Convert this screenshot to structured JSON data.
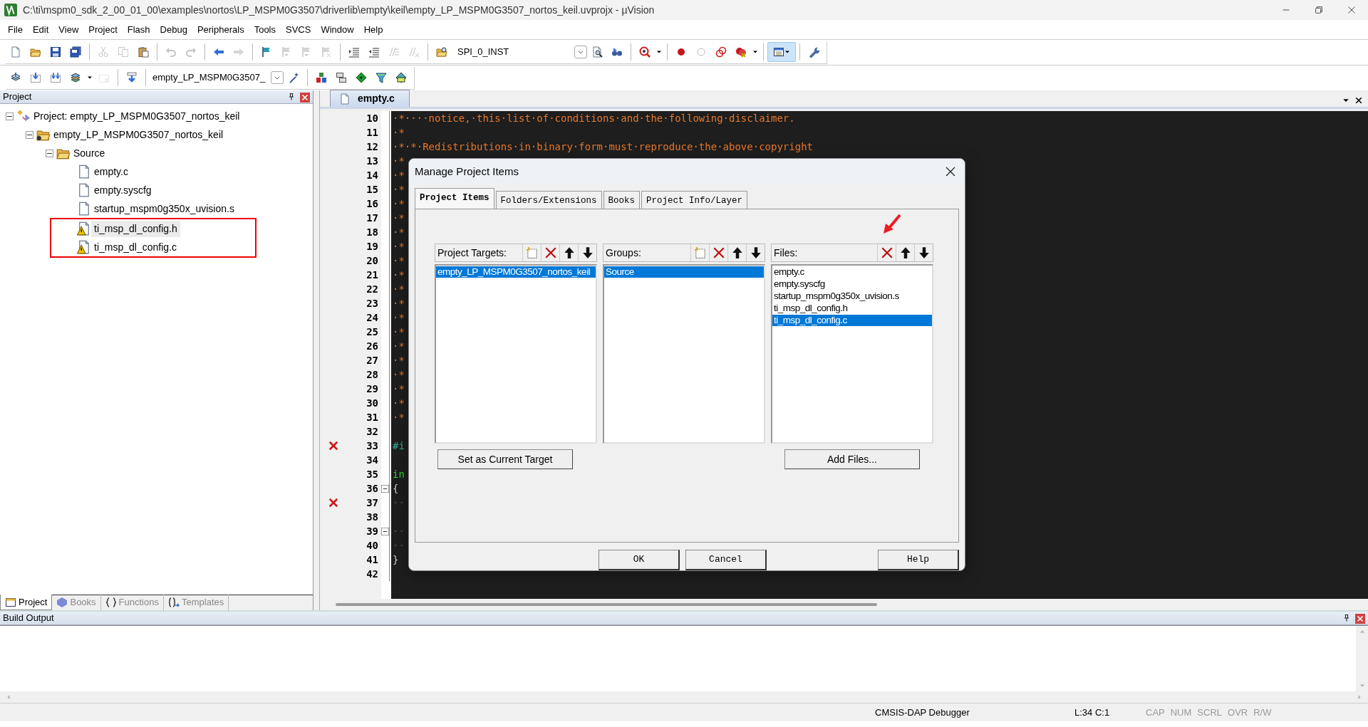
{
  "window": {
    "title": "C:\\ti\\mspm0_sdk_2_00_01_00\\examples\\nortos\\LP_MSPM0G3507\\driverlib\\empty\\keil\\empty_LP_MSPM0G3507_nortos_keil.uvprojx - µVision"
  },
  "menu": [
    "File",
    "Edit",
    "View",
    "Project",
    "Flash",
    "Debug",
    "Peripherals",
    "Tools",
    "SVCS",
    "Window",
    "Help"
  ],
  "toolbars": [
    {
      "items": [
        {
          "kind": "new",
          "disabled": false,
          "pressed": false
        },
        {
          "kind": "open",
          "disabled": false,
          "pressed": false
        },
        {
          "kind": "save",
          "disabled": false,
          "pressed": false
        },
        {
          "kind": "save-all",
          "disabled": false,
          "pressed": false
        },
        {
          "kind": "sep"
        },
        {
          "kind": "cut",
          "disabled": true,
          "pressed": false
        },
        {
          "kind": "copy",
          "disabled": true,
          "pressed": false
        },
        {
          "kind": "paste",
          "disabled": false,
          "pressed": false
        },
        {
          "kind": "sep"
        },
        {
          "kind": "undo",
          "disabled": true,
          "pressed": false
        },
        {
          "kind": "redo",
          "disabled": true,
          "pressed": false
        },
        {
          "kind": "sep"
        },
        {
          "kind": "back",
          "disabled": false,
          "pressed": false
        },
        {
          "kind": "forward",
          "disabled": true,
          "pressed": false
        },
        {
          "kind": "sep"
        },
        {
          "kind": "flag",
          "disabled": false,
          "pressed": false
        },
        {
          "kind": "flag-prev",
          "disabled": true,
          "pressed": false
        },
        {
          "kind": "flag-next",
          "disabled": true,
          "pressed": false
        },
        {
          "kind": "flag-clear",
          "disabled": true,
          "pressed": false
        },
        {
          "kind": "sep"
        },
        {
          "kind": "indent",
          "disabled": false,
          "pressed": false
        },
        {
          "kind": "unindent",
          "disabled": false,
          "pressed": false
        },
        {
          "kind": "comment",
          "disabled": true,
          "pressed": false
        },
        {
          "kind": "uncomment",
          "disabled": true,
          "pressed": false
        },
        {
          "kind": "sep"
        },
        {
          "kind": "find-files",
          "disabled": false,
          "pressed": false
        },
        {
          "kind": "combo",
          "value": "SPI_0_INST"
        },
        {
          "kind": "find",
          "disabled": false,
          "pressed": false
        },
        {
          "kind": "incremental",
          "disabled": false,
          "pressed": false
        },
        {
          "kind": "sep"
        },
        {
          "kind": "debug",
          "disabled": false,
          "pressed": false
        },
        {
          "kind": "caret"
        },
        {
          "kind": "sep"
        },
        {
          "kind": "breakpoint",
          "disabled": false,
          "pressed": false
        },
        {
          "kind": "breakpoint-off",
          "disabled": false,
          "pressed": false
        },
        {
          "kind": "breakpoints",
          "disabled": false,
          "pressed": false
        },
        {
          "kind": "breakpoints-kill",
          "disabled": false,
          "pressed": false
        },
        {
          "kind": "caret"
        },
        {
          "kind": "sep"
        },
        {
          "kind": "window",
          "disabled": false,
          "pressed": true
        },
        {
          "kind": "sep"
        },
        {
          "kind": "wrench",
          "disabled": false,
          "pressed": false
        }
      ]
    },
    {
      "items": [
        {
          "kind": "translate",
          "disabled": false,
          "pressed": false
        },
        {
          "kind": "build",
          "disabled": false,
          "pressed": false
        },
        {
          "kind": "rebuild",
          "disabled": false,
          "pressed": false
        },
        {
          "kind": "batch",
          "disabled": false,
          "pressed": false
        },
        {
          "kind": "caret"
        },
        {
          "kind": "stop",
          "disabled": true,
          "pressed": false
        },
        {
          "kind": "sep"
        },
        {
          "kind": "load",
          "disabled": false,
          "pressed": false
        },
        {
          "kind": "sep"
        },
        {
          "kind": "combo",
          "value": "empty_LP_MSPM0G3507_"
        },
        {
          "kind": "wand",
          "disabled": false,
          "pressed": false
        },
        {
          "kind": "sep"
        },
        {
          "kind": "manage",
          "disabled": false,
          "pressed": false
        },
        {
          "kind": "layers",
          "disabled": false,
          "pressed": false
        },
        {
          "kind": "diamond",
          "disabled": false,
          "pressed": false
        },
        {
          "kind": "funnel",
          "disabled": false,
          "pressed": false
        },
        {
          "kind": "pack",
          "disabled": false,
          "pressed": false
        }
      ]
    }
  ],
  "project_panel": {
    "title": "Project",
    "tree": [
      {
        "label": "Project: empty_LP_MSPM0G3507_nortos_keil",
        "kind": "project",
        "expanded": true,
        "children": [
          {
            "label": "empty_LP_MSPM0G3507_nortos_keil",
            "kind": "target",
            "expanded": true,
            "children": [
              {
                "label": "Source",
                "kind": "group",
                "expanded": true,
                "children": [
                  {
                    "label": "empty.c",
                    "kind": "file",
                    "selected": false,
                    "marked": false
                  },
                  {
                    "label": "empty.syscfg",
                    "kind": "file",
                    "selected": false,
                    "marked": false
                  },
                  {
                    "label": "startup_mspm0g350x_uvision.s",
                    "kind": "file",
                    "selected": false,
                    "marked": false
                  },
                  {
                    "label": "ti_msp_dl_config.h",
                    "kind": "warning-file",
                    "selected": true,
                    "marked": true
                  },
                  {
                    "label": "ti_msp_dl_config.c",
                    "kind": "warning-file",
                    "selected": false,
                    "marked": true
                  }
                ]
              }
            ]
          }
        ]
      }
    ],
    "tabs": [
      {
        "label": "Project",
        "selected": true
      },
      {
        "label": "Books",
        "selected": false
      },
      {
        "label": "Functions",
        "selected": false
      },
      {
        "label": "Templates",
        "selected": false
      }
    ]
  },
  "editor": {
    "tabs": [
      {
        "label": "empty.c",
        "selected": true
      }
    ],
    "lines": [
      {
        "number": "10",
        "kind": "comment",
        "text": "·*····notice,·this·list·of·conditions·and·the·following·disclaimer.",
        "error": false,
        "fold": false
      },
      {
        "number": "11",
        "kind": "comment",
        "text": "·*",
        "error": false,
        "fold": false
      },
      {
        "number": "12",
        "kind": "comment",
        "text": "·*·*·Redistributions·in·binary·form·must·reproduce·the·above·copyright",
        "error": false,
        "fold": false
      },
      {
        "number": "13",
        "kind": "comment",
        "text": "·*",
        "error": false,
        "fold": false
      },
      {
        "number": "14",
        "kind": "comment",
        "text": "·*",
        "error": false,
        "fold": false
      },
      {
        "number": "15",
        "kind": "comment",
        "text": "·*",
        "error": false,
        "fold": false
      },
      {
        "number": "16",
        "kind": "comment",
        "text": "·*",
        "error": false,
        "fold": false
      },
      {
        "number": "17",
        "kind": "comment",
        "text": "·*",
        "error": false,
        "fold": false
      },
      {
        "number": "18",
        "kind": "comment",
        "text": "·*",
        "error": false,
        "fold": false
      },
      {
        "number": "19",
        "kind": "comment",
        "text": "·*",
        "error": false,
        "fold": false
      },
      {
        "number": "20",
        "kind": "comment",
        "text": "·*",
        "error": false,
        "fold": false
      },
      {
        "number": "21",
        "kind": "comment",
        "text": "·*",
        "error": false,
        "fold": false
      },
      {
        "number": "22",
        "kind": "comment",
        "text": "·*",
        "error": false,
        "fold": false
      },
      {
        "number": "23",
        "kind": "comment",
        "text": "·*",
        "error": false,
        "fold": false
      },
      {
        "number": "24",
        "kind": "comment",
        "text": "·*",
        "error": false,
        "fold": false
      },
      {
        "number": "25",
        "kind": "comment",
        "text": "·*",
        "error": false,
        "fold": false
      },
      {
        "number": "26",
        "kind": "comment",
        "text": "·*",
        "error": false,
        "fold": false
      },
      {
        "number": "27",
        "kind": "comment",
        "text": "·*",
        "error": false,
        "fold": false
      },
      {
        "number": "28",
        "kind": "comment",
        "text": "·*",
        "error": false,
        "fold": false
      },
      {
        "number": "29",
        "kind": "comment",
        "text": "·*",
        "error": false,
        "fold": false
      },
      {
        "number": "30",
        "kind": "comment",
        "text": "·*",
        "error": false,
        "fold": false
      },
      {
        "number": "31",
        "kind": "comment",
        "text": "·*",
        "error": false,
        "fold": false
      },
      {
        "number": "32",
        "kind": "plain",
        "error": false,
        "fold": false
      },
      {
        "number": "33",
        "kind": "preprocessor",
        "text": "#i",
        "error": true,
        "fold": false
      },
      {
        "number": "34",
        "kind": "plain",
        "error": false,
        "fold": false
      },
      {
        "number": "35",
        "kind": "keyword",
        "text": "in",
        "error": false,
        "fold": false
      },
      {
        "number": "36",
        "kind": "plain",
        "text": "{",
        "error": false,
        "fold": true
      },
      {
        "number": "37",
        "kind": "whitespace",
        "text": "··",
        "error": true,
        "fold": false
      },
      {
        "number": "38",
        "kind": "plain",
        "error": false,
        "fold": false
      },
      {
        "number": "39",
        "kind": "whitespace",
        "text": "··",
        "error": false,
        "fold": true
      },
      {
        "number": "40",
        "kind": "whitespace",
        "text": "··",
        "error": false,
        "fold": false
      },
      {
        "number": "41",
        "kind": "plain",
        "text": "}",
        "error": false,
        "fold": false
      },
      {
        "number": "42",
        "kind": "plain",
        "error": false,
        "fold": false
      }
    ]
  },
  "dialog": {
    "title": "Manage Project Items",
    "tabs": [
      {
        "label": "Project Items",
        "selected": true
      },
      {
        "label": "Folders/Extensions",
        "selected": false
      },
      {
        "label": "Books",
        "selected": false
      },
      {
        "label": "Project Info/Layer",
        "selected": false
      }
    ],
    "lists": [
      {
        "label": "Project Targets:",
        "add_tool": true,
        "pointer": false,
        "items": [
          {
            "label": "empty_LP_MSPM0G3507_nortos_keil",
            "selected": true
          }
        ],
        "button": "Set as Current Target"
      },
      {
        "label": "Groups:",
        "add_tool": true,
        "pointer": false,
        "items": [
          {
            "label": "Source",
            "selected": true
          }
        ]
      },
      {
        "label": "Files:",
        "add_tool": false,
        "pointer": true,
        "items": [
          {
            "label": "empty.c",
            "selected": false
          },
          {
            "label": "empty.syscfg",
            "selected": false
          },
          {
            "label": "startup_mspm0g350x_uvision.s",
            "selected": false
          },
          {
            "label": "ti_msp_dl_config.h",
            "selected": false
          },
          {
            "label": "ti_msp_dl_config.c",
            "selected": true
          }
        ],
        "button": "Add Files..."
      }
    ],
    "buttons": [
      "OK",
      "Cancel",
      "Help"
    ]
  },
  "build_output": {
    "title": "Build Output"
  },
  "status_bar": [
    {
      "text": "CMSIS-DAP Debugger",
      "disabled": false
    },
    {
      "text": "L:34 C:1",
      "disabled": false
    },
    {
      "text": "CAP",
      "disabled": true
    },
    {
      "text": "NUM",
      "disabled": true
    },
    {
      "text": "SCRL",
      "disabled": true
    },
    {
      "text": "OVR",
      "disabled": true
    },
    {
      "text": "R/W",
      "disabled": true
    }
  ]
}
